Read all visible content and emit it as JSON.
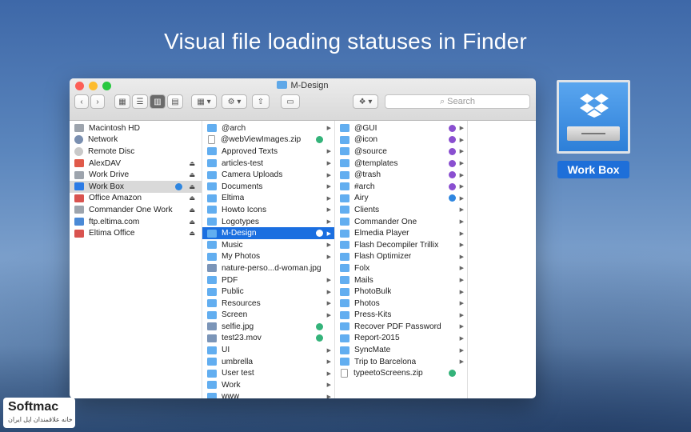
{
  "headline": "Visual file loading statuses in Finder",
  "window": {
    "title": "M-Design",
    "search_placeholder": "Search"
  },
  "toolbar": {
    "back": "‹",
    "forward": "›",
    "view_icon": "▦",
    "view_list": "☰",
    "view_column": "▥",
    "view_cover": "▤",
    "arrange": "▦ ▾",
    "action": "⚙ ▾",
    "share": "⇧",
    "tag": "▭",
    "dropbox": "❖ ▾",
    "search_icon": "⌕"
  },
  "colors": {
    "selection": "#1b6fe0",
    "folder": "#62aef0",
    "status_green": "#34b37a",
    "status_purple": "#8a4fd0",
    "status_blue": "#2f86e0"
  },
  "col1": [
    {
      "label": "Macintosh HD",
      "icon": "drive"
    },
    {
      "label": "Network",
      "icon": "net"
    },
    {
      "label": "Remote Disc",
      "icon": "disc"
    },
    {
      "label": "AlexDAV",
      "icon": "alex",
      "eject": true
    },
    {
      "label": "Work Drive",
      "icon": "drive",
      "eject": true
    },
    {
      "label": "Work Box",
      "icon": "box",
      "eject": true,
      "sync": true,
      "selected_light": true
    },
    {
      "label": "Office Amazon",
      "icon": "office",
      "eject": true
    },
    {
      "label": "Commander One Work",
      "icon": "drive",
      "eject": true
    },
    {
      "label": "ftp.eltima.com",
      "icon": "ftp",
      "eject": true
    },
    {
      "label": "Eltima Office",
      "icon": "office",
      "eject": true
    }
  ],
  "col2": [
    {
      "label": "@arch",
      "icon": "folder",
      "arrow": true
    },
    {
      "label": "@webViewImages.zip",
      "icon": "doc",
      "badge": "green"
    },
    {
      "label": "Approved Texts",
      "icon": "folder",
      "arrow": true
    },
    {
      "label": "articles-test",
      "icon": "folder",
      "arrow": true
    },
    {
      "label": "Camera Uploads",
      "icon": "folder",
      "arrow": true
    },
    {
      "label": "Documents",
      "icon": "folder",
      "arrow": true
    },
    {
      "label": "Eltima",
      "icon": "folder",
      "arrow": true
    },
    {
      "label": "Howto Icons",
      "icon": "folder",
      "arrow": true
    },
    {
      "label": "Logotypes",
      "icon": "folder",
      "arrow": true
    },
    {
      "label": "M-Design",
      "icon": "folder",
      "arrow": true,
      "selected": true,
      "sync": true
    },
    {
      "label": "Music",
      "icon": "folder",
      "arrow": true
    },
    {
      "label": "My Photos",
      "icon": "folder",
      "arrow": true
    },
    {
      "label": "nature-perso...d-woman.jpg",
      "icon": "img"
    },
    {
      "label": "PDF",
      "icon": "folder",
      "arrow": true
    },
    {
      "label": "Public",
      "icon": "folder",
      "arrow": true
    },
    {
      "label": "Resources",
      "icon": "folder",
      "arrow": true
    },
    {
      "label": "Screen",
      "icon": "folder",
      "arrow": true
    },
    {
      "label": "selfie.jpg",
      "icon": "img",
      "badge": "green"
    },
    {
      "label": "test23.mov",
      "icon": "img",
      "badge": "green"
    },
    {
      "label": "UI",
      "icon": "folder",
      "arrow": true
    },
    {
      "label": "umbrella",
      "icon": "folder",
      "arrow": true
    },
    {
      "label": "User test",
      "icon": "folder",
      "arrow": true
    },
    {
      "label": "Work",
      "icon": "folder",
      "arrow": true
    },
    {
      "label": "www",
      "icon": "folder",
      "arrow": true
    }
  ],
  "col3": [
    {
      "label": "@GUI",
      "icon": "folder",
      "arrow": true,
      "badge": "purple"
    },
    {
      "label": "@icon",
      "icon": "folder",
      "arrow": true,
      "badge": "purple"
    },
    {
      "label": "@source",
      "icon": "folder",
      "arrow": true,
      "badge": "purple"
    },
    {
      "label": "@templates",
      "icon": "folder",
      "arrow": true,
      "badge": "purple"
    },
    {
      "label": "@trash",
      "icon": "folder",
      "arrow": true,
      "badge": "purple"
    },
    {
      "label": "#arch",
      "icon": "folder",
      "arrow": true,
      "badge": "purple"
    },
    {
      "label": "Airy",
      "icon": "folder",
      "arrow": true,
      "badge": "blue"
    },
    {
      "label": "Clients",
      "icon": "folder",
      "arrow": true
    },
    {
      "label": "Commander One",
      "icon": "folder",
      "arrow": true
    },
    {
      "label": "Elmedia Player",
      "icon": "folder",
      "arrow": true
    },
    {
      "label": "Flash Decompiler Trillix",
      "icon": "folder",
      "arrow": true
    },
    {
      "label": "Flash Optimizer",
      "icon": "folder",
      "arrow": true
    },
    {
      "label": "Folx",
      "icon": "folder",
      "arrow": true
    },
    {
      "label": "Mails",
      "icon": "folder",
      "arrow": true
    },
    {
      "label": "PhotoBulk",
      "icon": "folder",
      "arrow": true
    },
    {
      "label": "Photos",
      "icon": "folder",
      "arrow": true
    },
    {
      "label": "Press-Kits",
      "icon": "folder",
      "arrow": true
    },
    {
      "label": "Recover PDF Password",
      "icon": "folder",
      "arrow": true
    },
    {
      "label": "Report-2015",
      "icon": "folder",
      "arrow": true
    },
    {
      "label": "SyncMate",
      "icon": "folder",
      "arrow": true
    },
    {
      "label": "Trip to Barcelona",
      "icon": "folder",
      "arrow": true
    },
    {
      "label": "typeetoScreens.zip",
      "icon": "doc",
      "badge": "green"
    }
  ],
  "workbox": {
    "label": "Work Box",
    "icon": "dropbox-drive-icon"
  },
  "watermark": {
    "brand": "Softmac",
    "sub": "خانه علاقمندان اپل ایران"
  }
}
